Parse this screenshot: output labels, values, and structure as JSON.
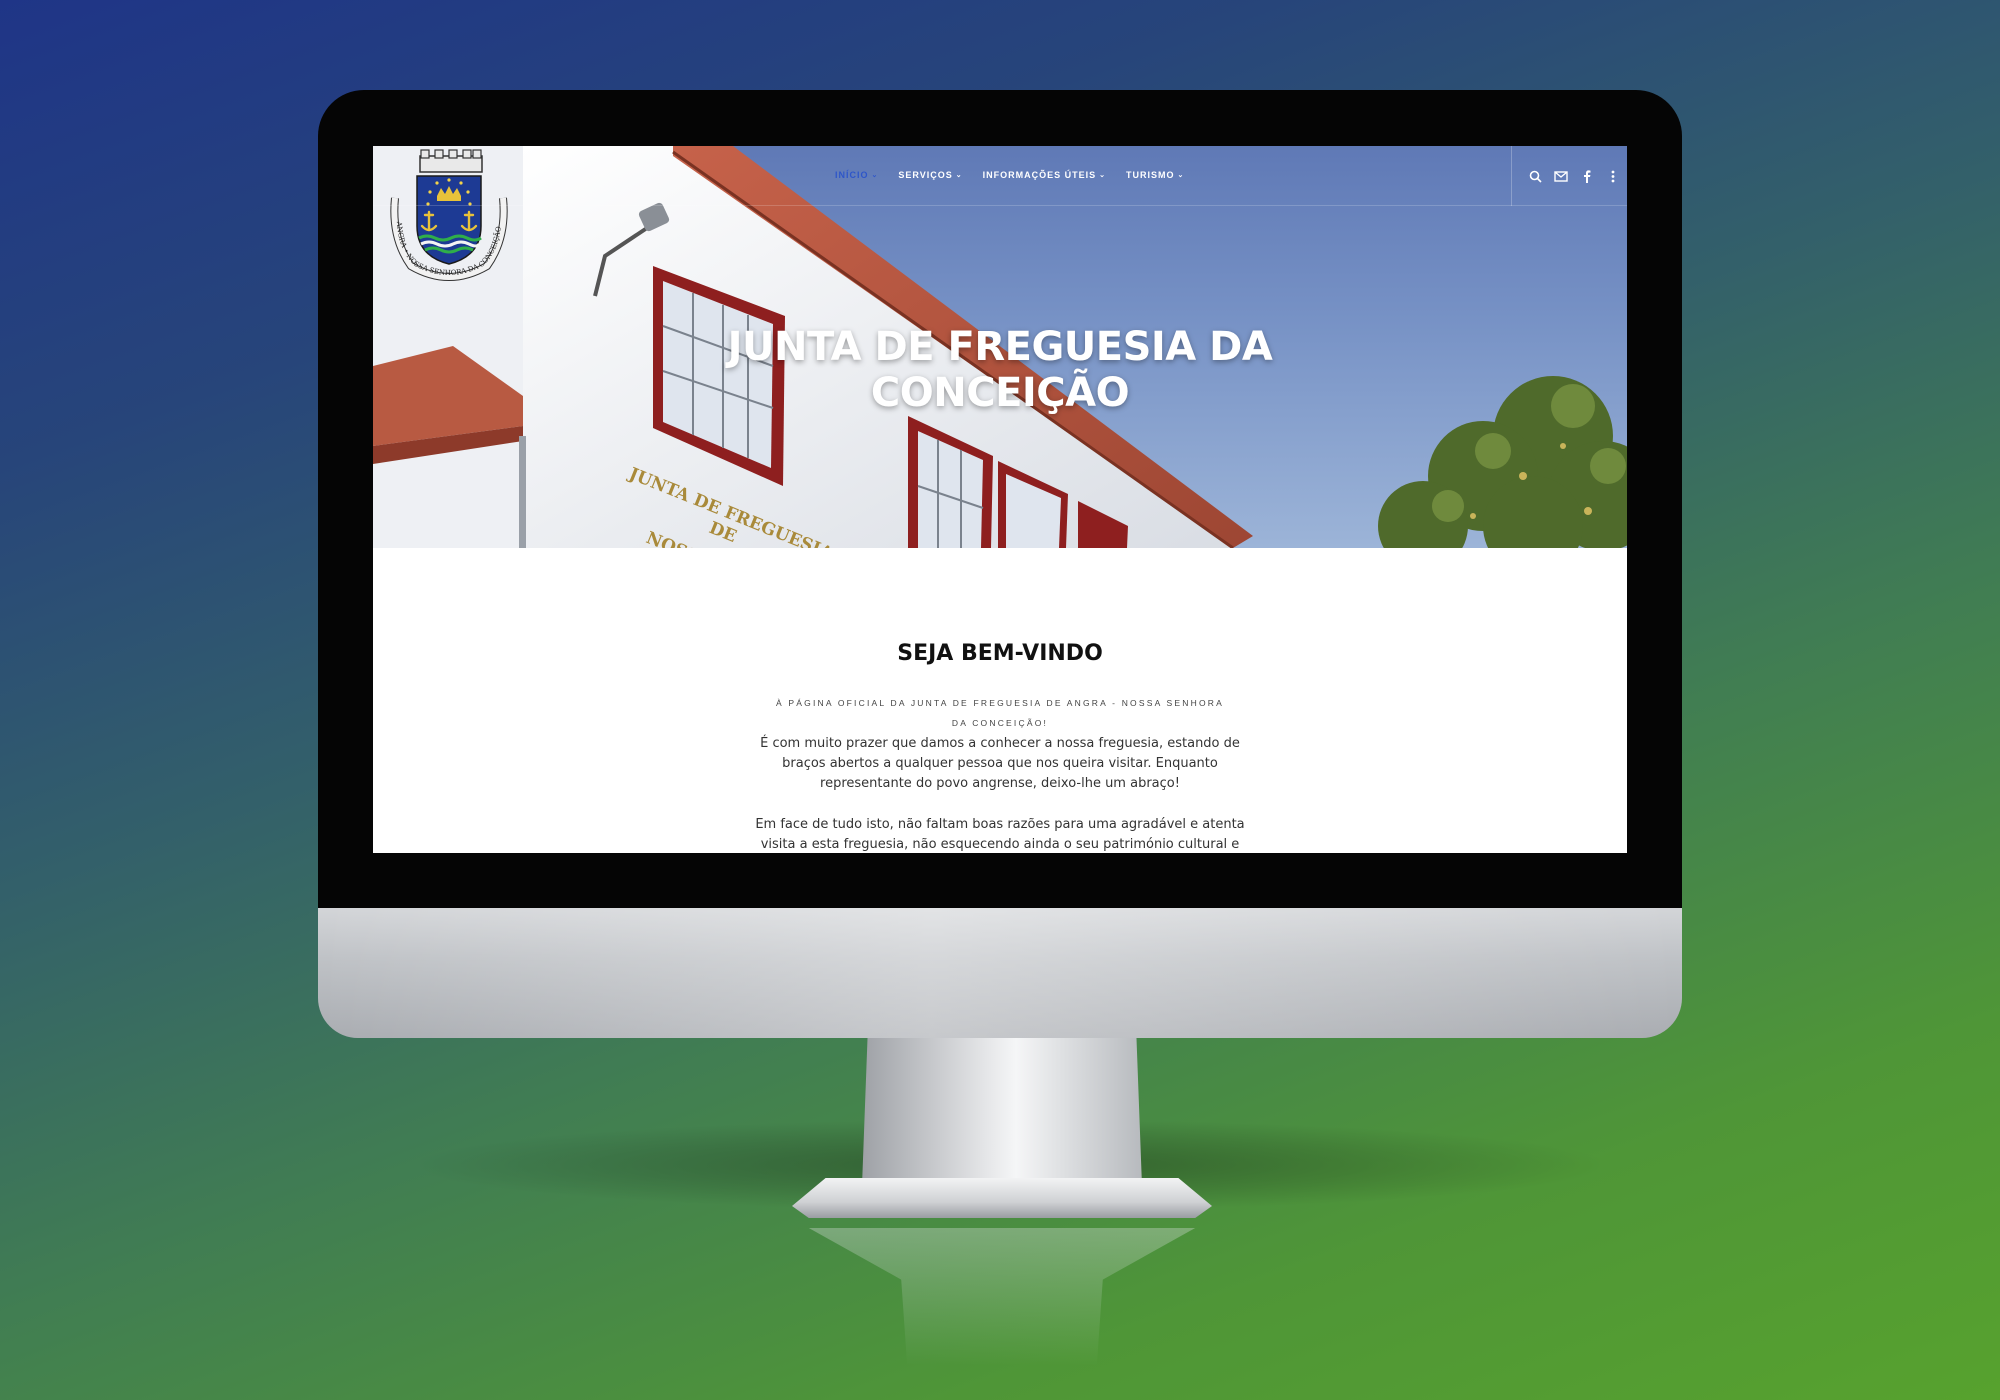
{
  "nav": {
    "items": [
      {
        "label": "INÍCIO",
        "active": true
      },
      {
        "label": "SERVIÇOS",
        "active": false
      },
      {
        "label": "INFORMAÇÕES ÚTEIS",
        "active": false
      },
      {
        "label": "TURISMO",
        "active": false
      }
    ],
    "icons": [
      "search-icon",
      "mail-icon",
      "facebook-icon",
      "more-vertical-icon"
    ],
    "active_color": "#2e56c9"
  },
  "logo": {
    "ribbon_text": "ANGRA • NOSSA SENHORA DA CONCEIÇÃO"
  },
  "hero": {
    "title_line1": "JUNTA DE FREGUESIA DA",
    "title_line2": "CONCEIÇÃO",
    "building_sign": [
      "JUNTA DE FREGUESIA",
      "DE",
      "NOSSA"
    ]
  },
  "welcome": {
    "title": "SEJA BEM-VINDO",
    "subtitle": "À PÁGINA OFICIAL DA JUNTA DE FREGUESIA DE ANGRA - NOSSA SENHORA DA CONCEIÇÃO!",
    "paragraph1": "É com muito prazer que damos a conhecer a nossa freguesia, estando de braços abertos a qualquer pessoa que nos queira visitar. Enquanto representante do povo angrense, deixo-lhe um abraço!",
    "paragraph2": "Em face de tudo isto, não faltam boas razões para uma agradável e atenta visita a esta freguesia, não esquecendo ainda o seu património cultural e popular, no"
  },
  "colors": {
    "background_top": "#1f3587",
    "background_bottom": "#57a22e",
    "hero_sky": "#7893c6",
    "window_frames": "#8e1f1f",
    "roof_tiles": "#b5523c"
  }
}
